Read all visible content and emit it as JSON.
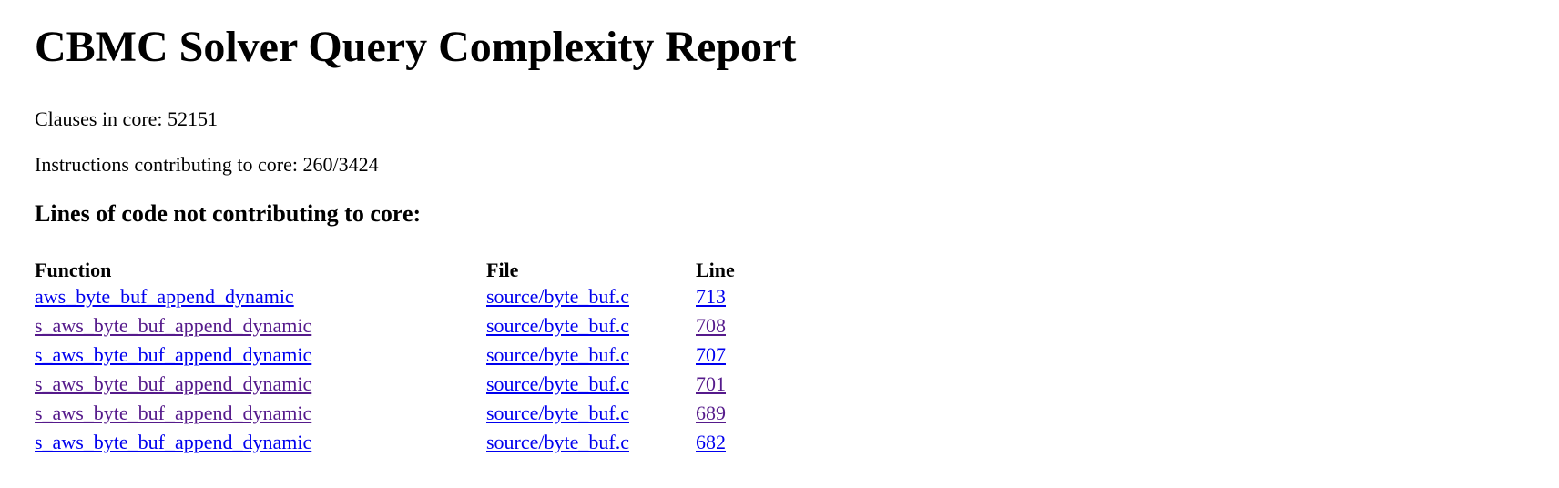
{
  "page": {
    "title": "CBMC Solver Query Complexity Report",
    "clauses_label": "Clauses in core: 52151",
    "instructions_label": "Instructions contributing to core: 260/3424",
    "section_heading": "Lines of code not contributing to core:"
  },
  "table": {
    "headers": {
      "function": "Function",
      "file": "File",
      "line": "Line"
    },
    "rows": [
      {
        "function": "aws_byte_buf_append_dynamic",
        "file": "source/byte_buf.c",
        "line": "713"
      },
      {
        "function": "s_aws_byte_buf_append_dynamic",
        "file": "source/byte_buf.c",
        "line": "708"
      },
      {
        "function": "s_aws_byte_buf_append_dynamic",
        "file": "source/byte_buf.c",
        "line": "707"
      },
      {
        "function": "s_aws_byte_buf_append_dynamic",
        "file": "source/byte_buf.c",
        "line": "701"
      },
      {
        "function": "s_aws_byte_buf_append_dynamic",
        "file": "source/byte_buf.c",
        "line": "689"
      },
      {
        "function": "s_aws_byte_buf_append_dynamic",
        "file": "source/byte_buf.c",
        "line": "682"
      }
    ]
  },
  "colors": {
    "link_unvisited": "#0000ee",
    "link_visited": "#551a8b"
  }
}
